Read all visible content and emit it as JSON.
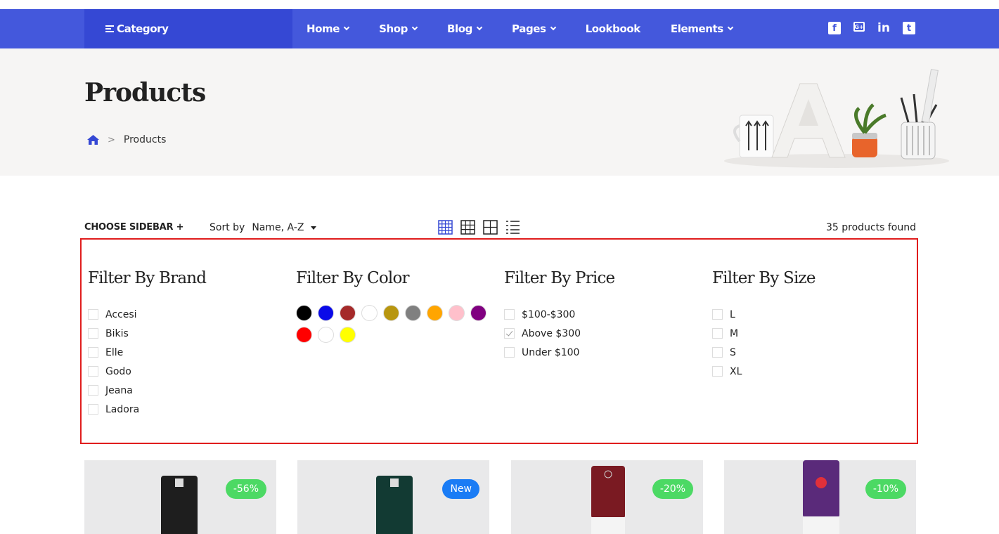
{
  "nav": {
    "category_label": "Category",
    "items": [
      {
        "label": "Home",
        "dropdown": true
      },
      {
        "label": "Shop",
        "dropdown": true
      },
      {
        "label": "Blog",
        "dropdown": true
      },
      {
        "label": "Pages",
        "dropdown": true
      },
      {
        "label": "Lookbook",
        "dropdown": false
      },
      {
        "label": "Elements",
        "dropdown": true
      }
    ],
    "social": {
      "facebook": "f",
      "google": "G+",
      "linkedin": "in",
      "twitter": "t"
    }
  },
  "banner": {
    "title": "Products",
    "breadcrumb_current": "Products"
  },
  "toolbar": {
    "choose_sidebar": "CHOOSE SIDEBAR +",
    "sort_label": "Sort by",
    "sort_value": "Name, A-Z",
    "products_found": "35 products found"
  },
  "filters": {
    "brand": {
      "title": "Filter By Brand",
      "options": [
        "Accesi",
        "Bikis",
        "Elle",
        "Godo",
        "Jeana",
        "Ladora"
      ]
    },
    "color": {
      "title": "Filter By Color",
      "swatches": [
        "#000000",
        "#0a0ae8",
        "#a52a2a",
        "#ffffff",
        "#b8960f",
        "#808080",
        "#ffa500",
        "#ffc0cb",
        "#800080",
        "#ff0000",
        "#ffffff",
        "#ffff00"
      ]
    },
    "price": {
      "title": "Filter By Price",
      "options": [
        "$100-$300",
        "Above $300",
        "Under $100"
      ],
      "checked": "Above $300"
    },
    "size": {
      "title": "Filter By Size",
      "options": [
        "L",
        "M",
        "S",
        "XL"
      ]
    }
  },
  "products": [
    {
      "badge": "-56%",
      "badge_color": "#4cd964",
      "mat_color": "#1e1e1e"
    },
    {
      "badge": "New",
      "badge_color": "#1a7cf5",
      "mat_color": "#123a33"
    },
    {
      "badge": "-20%",
      "badge_color": "#4cd964",
      "mat_color": "#7a1a22"
    },
    {
      "badge": "-10%",
      "badge_color": "#4cd964",
      "mat_color": "#5a2a7a"
    }
  ],
  "colors": {
    "nav": "#4458dc",
    "nav_category": "#3548d4",
    "highlight_border": "#e01d1d"
  }
}
